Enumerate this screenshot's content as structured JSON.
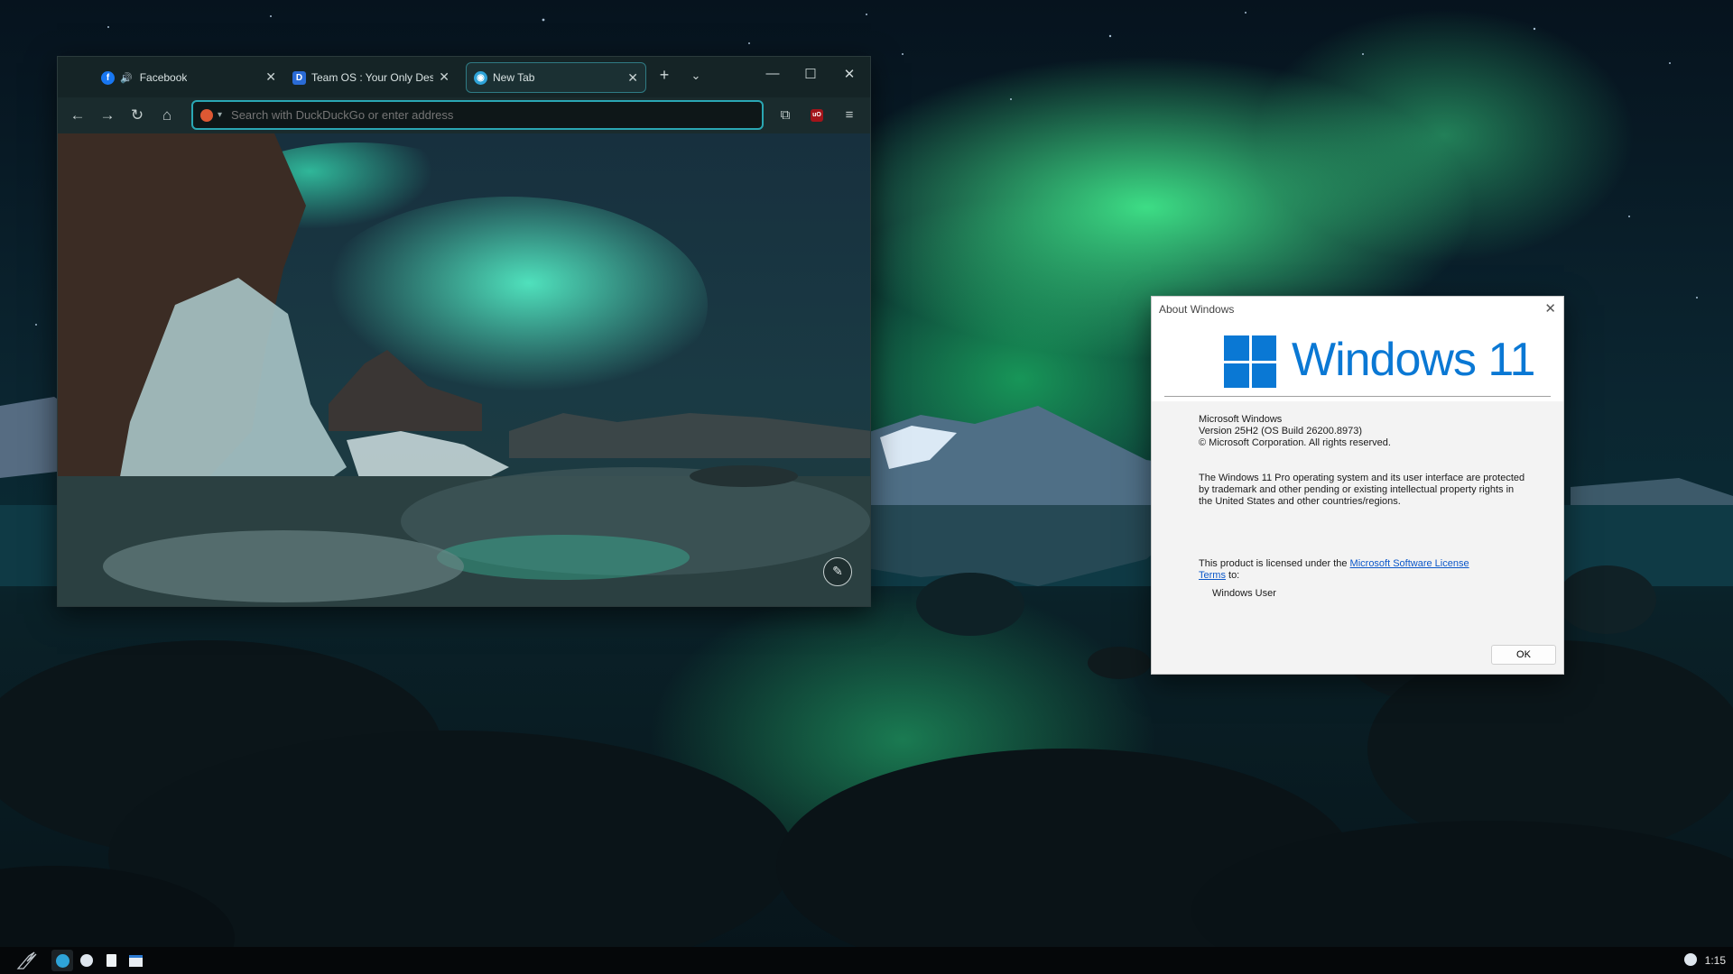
{
  "browser": {
    "tabs": [
      {
        "title": "Facebook",
        "favicon": "facebook-icon",
        "audio": true
      },
      {
        "title": "Team OS : Your Only Destin",
        "favicon": "teamos-icon",
        "audio": false
      },
      {
        "title": "New Tab",
        "favicon": "browser-icon",
        "audio": false
      }
    ],
    "url_placeholder": "Search with DuckDuckGo or enter address",
    "accent_color": "#2aa7b3"
  },
  "about": {
    "window_title": "About Windows",
    "logo_text": "Windows 11",
    "product": "Microsoft Windows",
    "version": "Version 25H2 (OS Build 26200.8973)",
    "copyright": "© Microsoft Corporation. All rights reserved.",
    "description_1": "The Windows 11 Pro operating system and its user interface are protected",
    "description_2": "by trademark and other pending or existing intellectual property rights in",
    "description_3": "the United States and other countries/regions.",
    "license_prefix": "This product is licensed under the ",
    "license_link_1": "Microsoft Software License",
    "license_link_2": "Terms",
    "license_suffix": " to:",
    "licensed_user": "Windows User",
    "ok_label": "OK",
    "brand_color": "#0a78d4"
  },
  "taskbar": {
    "clock": "1:15",
    "items": [
      "start-icon",
      "browser-icon",
      "steam-icon",
      "notepad-icon",
      "window-icon"
    ]
  }
}
